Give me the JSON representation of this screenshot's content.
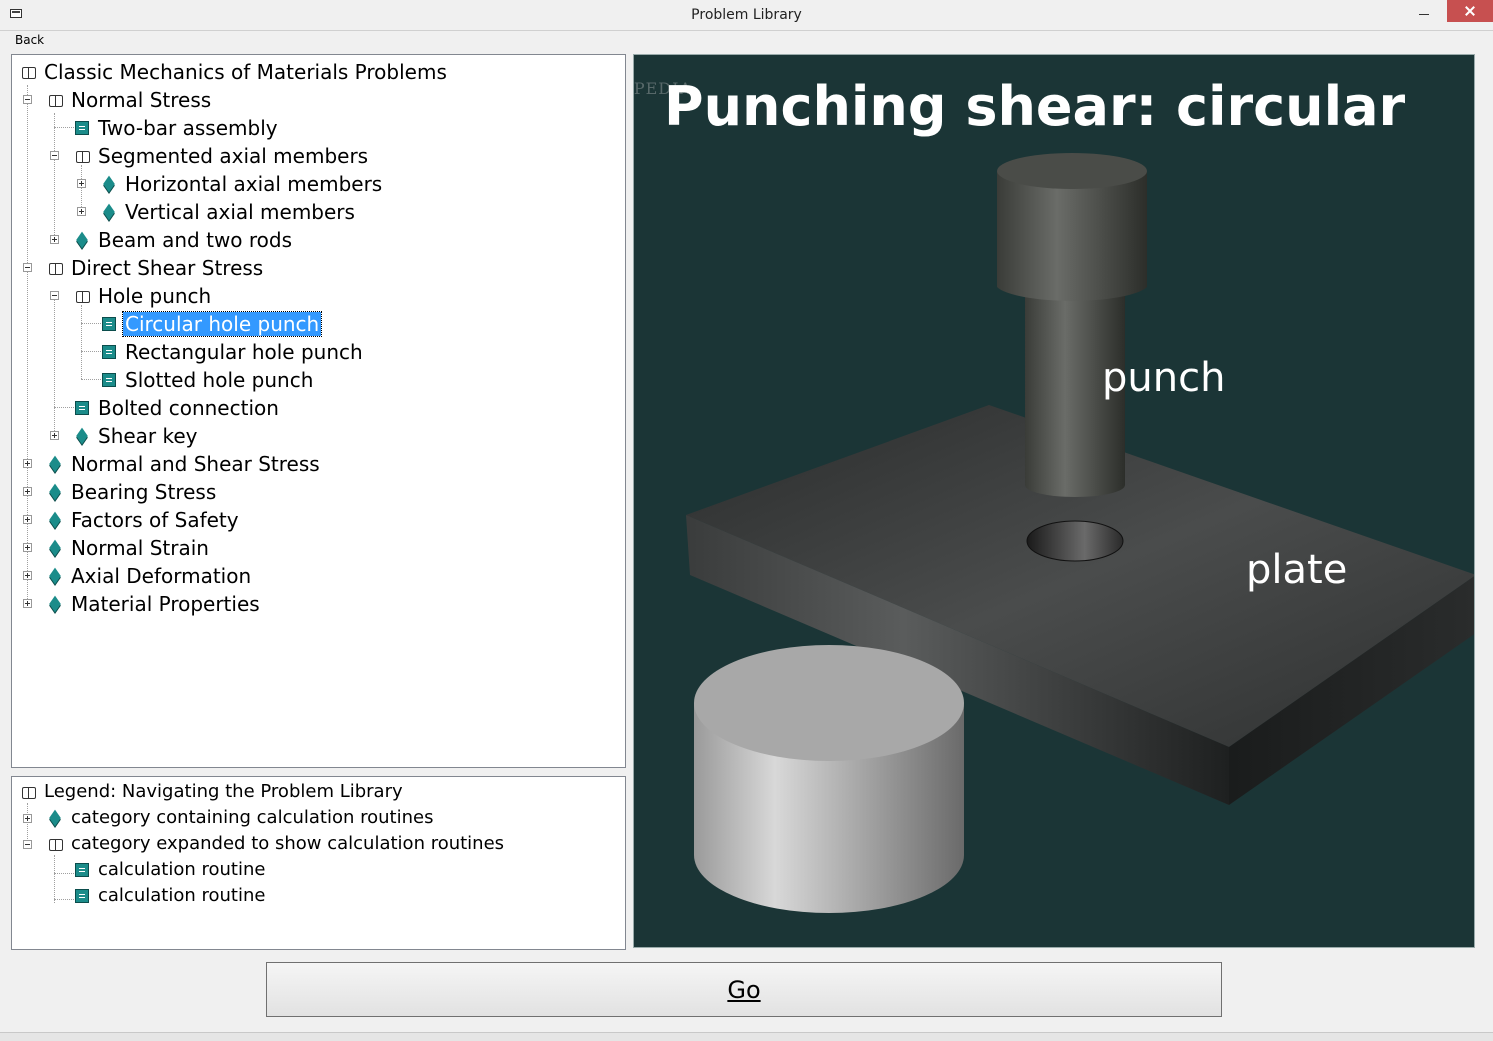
{
  "window": {
    "title": "Problem Library"
  },
  "menu": {
    "back": "Back"
  },
  "tree": {
    "root": "Classic Mechanics of Materials Problems",
    "normal_stress": "Normal Stress",
    "two_bar": "Two-bar assembly",
    "segmented": "Segmented axial members",
    "horizontal": "Horizontal axial members",
    "vertical": "Vertical axial members",
    "beam_rods": "Beam and two rods",
    "direct_shear": "Direct Shear Stress",
    "hole_punch": "Hole punch",
    "circular": "Circular hole punch",
    "rectangular": "Rectangular hole punch",
    "slotted": "Slotted hole punch",
    "bolted": "Bolted connection",
    "shear_key": "Shear key",
    "normal_shear": "Normal and Shear Stress",
    "bearing": "Bearing Stress",
    "safety": "Factors of Safety",
    "normal_strain": "Normal Strain",
    "axial_def": "Axial Deformation",
    "material": "Material Properties"
  },
  "legend": {
    "title": "Legend:  Navigating the Problem Library",
    "category": "category containing calculation routines",
    "expanded": "category expanded to show calculation routines",
    "routine1": "calculation routine",
    "routine2": "calculation routine"
  },
  "preview": {
    "title": "Punching shear: circular",
    "punch_label": "punch",
    "plate_label": "plate",
    "watermark": "SOFTPEDIA"
  },
  "go": {
    "label": "Go"
  }
}
